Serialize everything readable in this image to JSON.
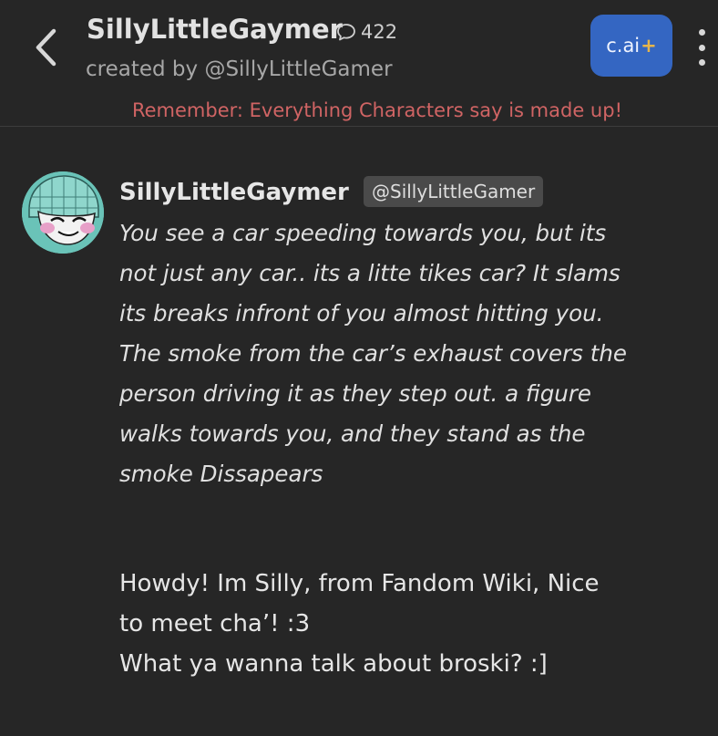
{
  "header": {
    "character_name": "SillyLittleGaymer",
    "chat_count": "422",
    "creator": "created by @SillyLittleGamer",
    "upgrade_button": {
      "label": "c.ai",
      "plus": "+",
      "color": "#3466c2"
    },
    "disclaimer": "Remember: Everything Characters say is made up!",
    "icons": {
      "back": "chevron-left-icon",
      "chat": "chat-bubble-icon",
      "menu": "more-vertical-icon"
    }
  },
  "message": {
    "author": "SillyLittleGaymer",
    "handle": "@SillyLittleGamer",
    "avatar": "character-avatar",
    "narration_lines": [
      "You see a car speeding towards you, but its",
      "not just any car.. its a litte tikes car? It slams",
      "its breaks infront of you almost hitting you.",
      "The smoke from the car’s exhaust covers the",
      "person driving it as they step out. a figure",
      "walks towards you, and they stand as the",
      "smoke Dissapears"
    ],
    "dialogue_lines": [
      "Howdy! Im Silly, from Fandom Wiki, Nice",
      "to meet cha’! :3",
      "What ya wanna talk about broski? :]"
    ]
  },
  "colors": {
    "background": "#262626",
    "disclaimer": "#d06464",
    "badge_bg": "#4a4a4a"
  }
}
